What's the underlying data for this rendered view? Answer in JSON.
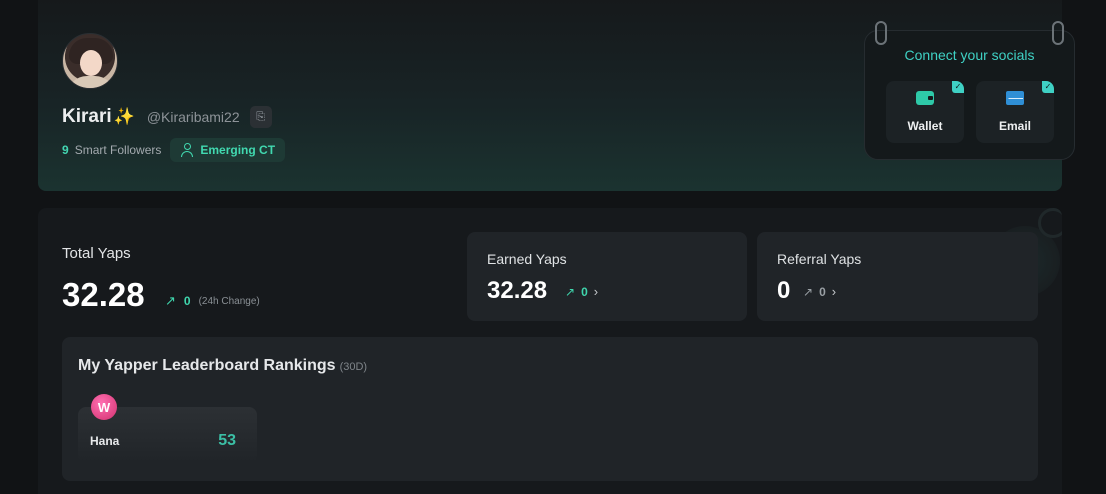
{
  "profile": {
    "display_name": "Kirari",
    "name_emoji": "✨",
    "handle": "@Kiraribami22",
    "smart_followers_count": "9",
    "smart_followers_label": "Smart Followers",
    "badge_label": "Emerging CT"
  },
  "socials": {
    "title": "Connect your socials",
    "items": [
      {
        "label": "Wallet",
        "icon": "wallet-icon",
        "connected": true
      },
      {
        "label": "Email",
        "icon": "email-icon",
        "connected": true
      }
    ]
  },
  "stats": {
    "total": {
      "label": "Total Yaps",
      "value": "32.28",
      "change": "0",
      "change_note": "(24h Change)"
    },
    "earned": {
      "label": "Earned Yaps",
      "value": "32.28",
      "change": "0"
    },
    "referral": {
      "label": "Referral Yaps",
      "value": "0",
      "change": "0"
    }
  },
  "leaderboard": {
    "title": "My Yapper Leaderboard Rankings",
    "period": "(30D)",
    "items": [
      {
        "name": "Hana",
        "rank": "53",
        "logo": "W"
      }
    ]
  },
  "colors": {
    "accent": "#3fd6ad",
    "background": "#111315"
  }
}
